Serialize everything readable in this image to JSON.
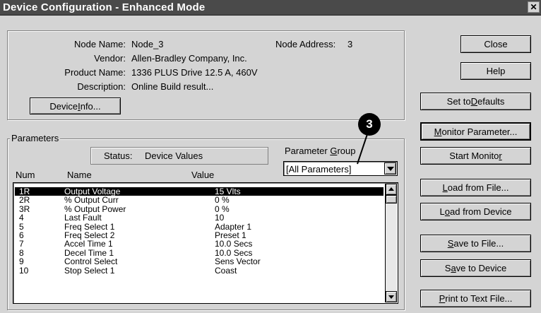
{
  "window": {
    "title": "Device Configuration - Enhanced Mode",
    "close_glyph": "✕"
  },
  "device": {
    "node_name_label": "Node Name:",
    "node_name": "Node_3",
    "node_address_label": "Node Address:",
    "node_address": "3",
    "vendor_label": "Vendor:",
    "vendor": "Allen-Bradley Company, Inc.",
    "product_name_label": "Product Name:",
    "product_name": "1336 PLUS Drive  12.5 A, 460V",
    "description_label": "Description:",
    "description": "Online Build result...",
    "device_info_button_pre": "Device ",
    "device_info_button_u": "I",
    "device_info_button_post": "nfo..."
  },
  "parameters": {
    "group_title": "Parameters",
    "status_label": "Status:",
    "status_value": "Device Values",
    "group_label_pre": "Parameter ",
    "group_label_u": "G",
    "group_label_post": "roup",
    "group_selected": "[All Parameters]",
    "columns": {
      "num": "Num",
      "name": "Name",
      "value": "Value"
    },
    "rows": [
      {
        "num": "1R",
        "name": "Output Voltage",
        "value": "15 Vlts",
        "selected": true
      },
      {
        "num": "2R",
        "name": "% Output Curr",
        "value": "0 %"
      },
      {
        "num": "3R",
        "name": "% Output Power",
        "value": "0 %"
      },
      {
        "num": "4",
        "name": "Last Fault",
        "value": "10"
      },
      {
        "num": "5",
        "name": "Freq Select 1",
        "value": "Adapter 1"
      },
      {
        "num": "6",
        "name": "Freq Select 2",
        "value": "Preset 1"
      },
      {
        "num": "7",
        "name": "Accel Time 1",
        "value": "10.0 Secs"
      },
      {
        "num": "8",
        "name": "Decel Time 1",
        "value": "10.0 Secs"
      },
      {
        "num": "9",
        "name": "Control Select",
        "value": "Sens Vector"
      },
      {
        "num": "10",
        "name": "Stop Select 1",
        "value": "Coast"
      }
    ]
  },
  "buttons": {
    "close": {
      "pre": "Close",
      "u": "",
      "post": ""
    },
    "help": {
      "pre": "Help",
      "u": "",
      "post": ""
    },
    "set_defaults": {
      "pre": "Set to ",
      "u": "D",
      "post": "efaults"
    },
    "monitor_parameter": {
      "pre": "",
      "u": "M",
      "post": "onitor Parameter..."
    },
    "start_monitor": {
      "pre": "Start Monito",
      "u": "r",
      "post": ""
    },
    "load_file": {
      "pre": "",
      "u": "L",
      "post": "oad from File..."
    },
    "load_device": {
      "pre": "L",
      "u": "o",
      "post": "ad from Device"
    },
    "save_file": {
      "pre": "",
      "u": "S",
      "post": "ave to File..."
    },
    "save_device": {
      "pre": "S",
      "u": "a",
      "post": "ve to Device"
    },
    "print_text": {
      "pre": "",
      "u": "P",
      "post": "rint to Text File..."
    }
  },
  "annotation": {
    "callout_number": "3"
  }
}
